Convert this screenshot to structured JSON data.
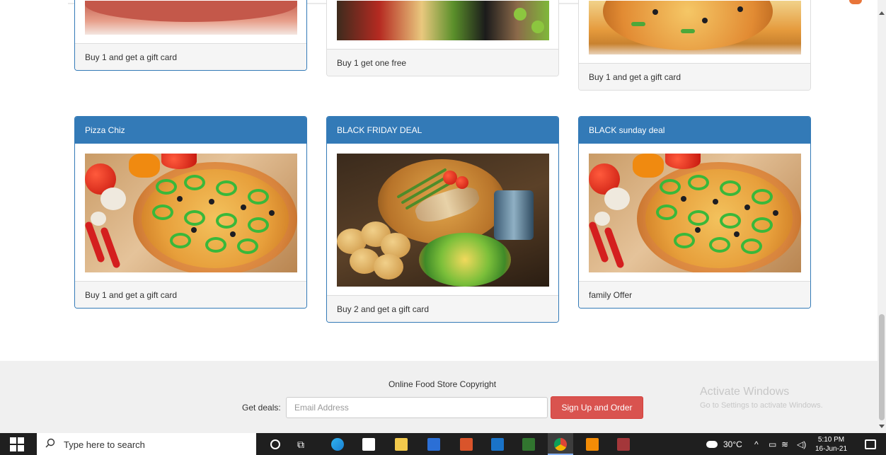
{
  "cards": [
    {
      "footer": "Buy 1 and get a gift card"
    },
    {
      "footer": "Buy 1 get one free"
    },
    {
      "footer": "Buy 1 and get a gift card"
    },
    {
      "title": "Pizza Chiz",
      "footer": "Buy 1 and get a gift card"
    },
    {
      "title": "BLACK FRIDAY DEAL",
      "footer": "Buy 2 and get a gift card"
    },
    {
      "title": "BLACK sunday deal",
      "footer": "family Offer"
    }
  ],
  "footer": {
    "copyright": "Online Food Store Copyright",
    "deals_label": "Get deals:",
    "email_placeholder": "Email Address",
    "signup_label": "Sign Up and Order"
  },
  "watermark": {
    "title": "Activate Windows",
    "subtitle": "Go to Settings to activate Windows."
  },
  "taskbar": {
    "search_placeholder": "Type here to search",
    "weather": "30°C",
    "time": "5:10 PM",
    "date": "16-Jun-21"
  }
}
